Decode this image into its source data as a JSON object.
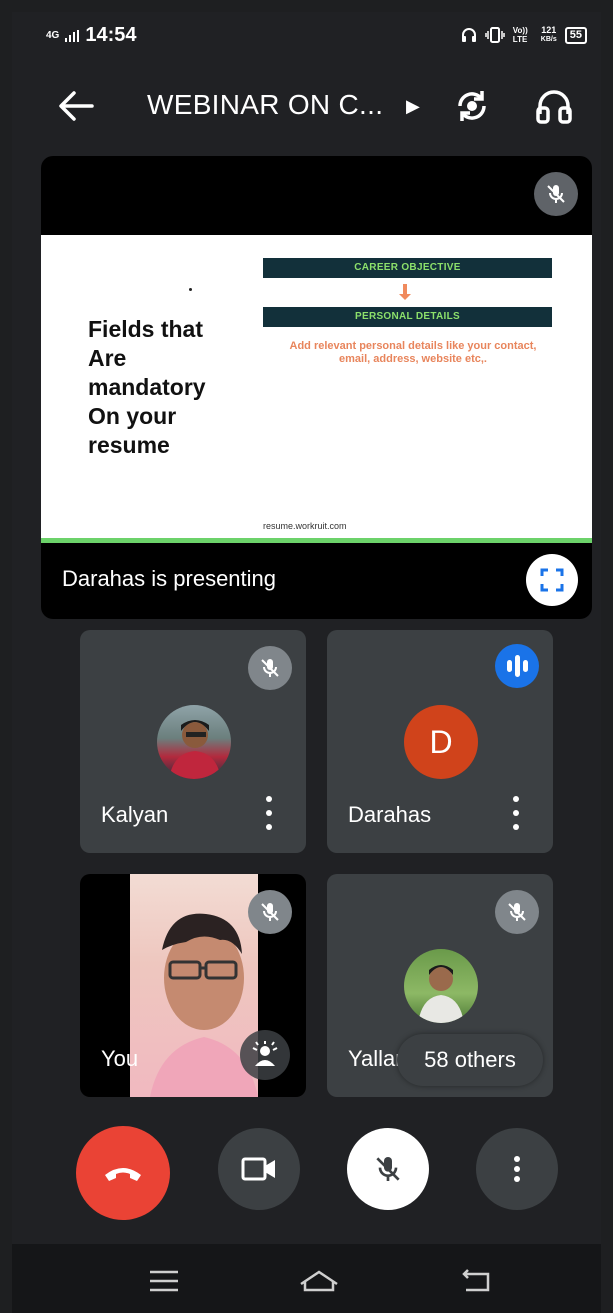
{
  "status_bar": {
    "network": "4G",
    "time": "14:54",
    "volte": "Vo)) LTE",
    "speed_value": "121",
    "speed_unit": "KB/s",
    "battery": "55"
  },
  "app_bar": {
    "meeting_title": "WEBINAR ON C...",
    "icons": [
      "back-arrow-icon",
      "chevron-right-icon",
      "switch-camera-icon",
      "headphones-icon"
    ]
  },
  "presentation": {
    "slide": {
      "heading": "Fields that\nAre\nmandatory\nOn your\nresume",
      "bar1": "CAREER OBJECTIVE",
      "bar2": "PERSONAL DETAILS",
      "description": "Add relevant personal details like your contact, email, address, website etc,.",
      "footer": "resume.workruit.com"
    },
    "label": "Darahas is presenting"
  },
  "participants": [
    {
      "name": "Kalyan",
      "status": "muted"
    },
    {
      "name": "Darahas",
      "initial": "D",
      "status": "speaking"
    },
    {
      "name": "You",
      "status": "muted"
    },
    {
      "name": "Yallar",
      "status": "muted"
    }
  ],
  "others_chip": "58 others",
  "controls": [
    "end-call",
    "camera",
    "microphone-muted",
    "more-options"
  ],
  "colors": {
    "background": "#202124",
    "tile": "#3c4043",
    "end_call": "#ea4335",
    "speaking": "#1a73e8",
    "avatar_d": "#d0431b"
  }
}
